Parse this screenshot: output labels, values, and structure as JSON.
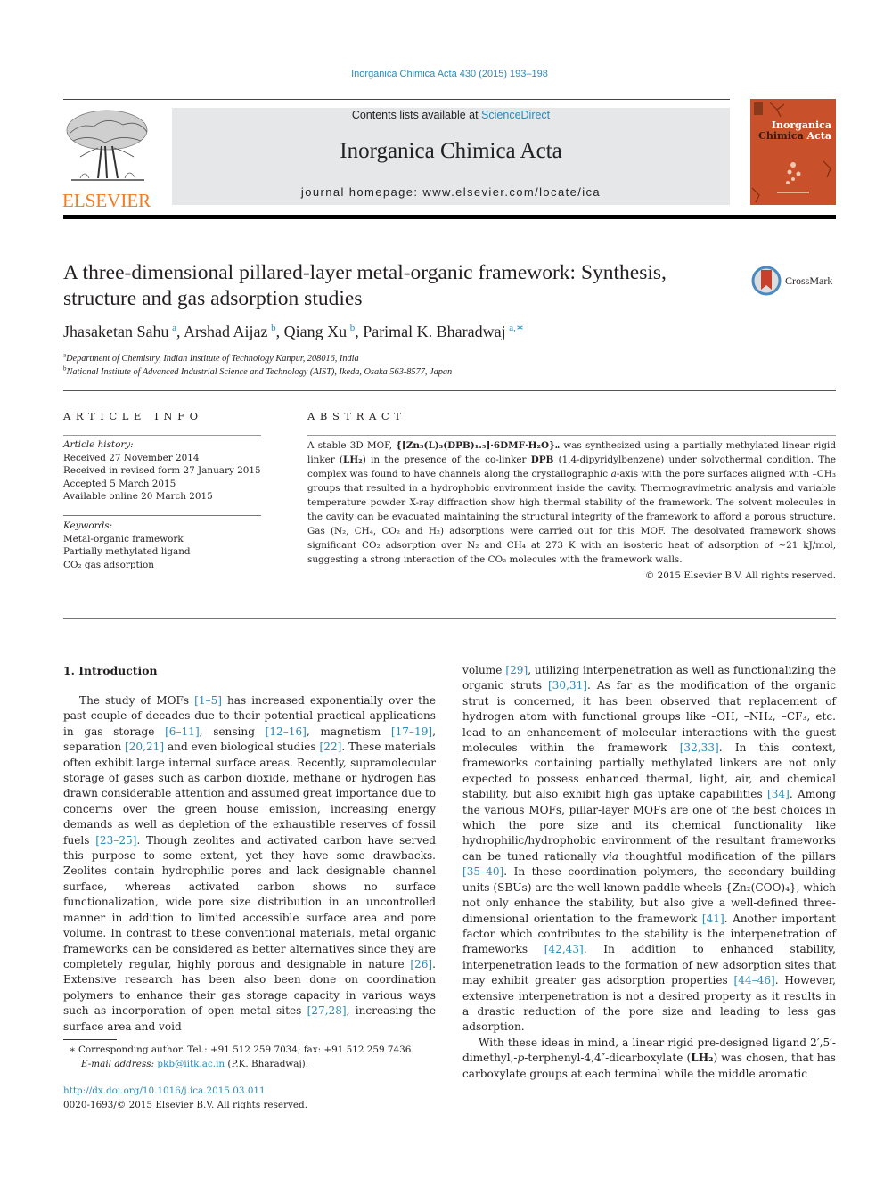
{
  "header": {
    "citation": "Inorganica Chimica Acta 430 (2015) 193–198",
    "contents_prefix": "Contents lists available at ",
    "contents_link": "ScienceDirect",
    "journal_title": "Inorganica Chimica Acta",
    "homepage": "journal homepage: www.elsevier.com/locate/ica",
    "publisher_logo": "ELSEVIER",
    "cover": {
      "line1": "Inorganica",
      "line2a": "Chimica",
      "line2b": "Acta",
      "bg_color": "#c8502a"
    },
    "link_color": "#2a8ab7",
    "logo_color": "#f47b20"
  },
  "article": {
    "title": "A three-dimensional pillared-layer metal-organic framework: Synthesis, structure and gas adsorption studies",
    "crossmark_label": "CrossMark",
    "authors": [
      {
        "name": "Jhasaketan Sahu",
        "aff": "a"
      },
      {
        "name": "Arshad Aijaz",
        "aff": "b"
      },
      {
        "name": "Qiang Xu",
        "aff": "b"
      },
      {
        "name": "Parimal K. Bharadwaj",
        "aff": "a,∗"
      }
    ],
    "affiliations": [
      {
        "mark": "a",
        "text": "Department of Chemistry, Indian Institute of Technology Kanpur, 208016, India"
      },
      {
        "mark": "b",
        "text": "National Institute of Advanced Industrial Science and Technology (AIST), Ikeda, Osaka 563-8577, Japan"
      }
    ]
  },
  "article_info": {
    "heading": "ARTICLE INFO",
    "history_label": "Article history:",
    "history": [
      "Received 27 November 2014",
      "Received in revised form 27 January 2015",
      "Accepted 5 March 2015",
      "Available online 20 March 2015"
    ],
    "keywords_label": "Keywords:",
    "keywords": [
      "Metal-organic framework",
      "Partially methylated ligand",
      "CO₂ gas adsorption"
    ]
  },
  "abstract": {
    "heading": "ABSTRACT",
    "s1_pre": "A stable 3D MOF, ",
    "formula": "{[Zn₃(L)₃(DPB)₁.₅]·6DMF·H₂O}ₙ",
    "s1_post": " was synthesized using a partially methylated linear rigid linker (",
    "lh2": "LH₂",
    "s1_mid": ") in the presence of the co-linker ",
    "dpb": "DPB",
    "s1_end": " (1,4-dipyridylbenzene) under solvothermal condition. The complex was found to have channels along the crystallographic ",
    "axis": "a",
    "s2": "-axis with the pore surfaces aligned with –CH₃ groups that resulted in a hydrophobic environment inside the cavity. Thermogravimetric analysis and variable temperature powder X-ray diffraction show high thermal stability of the framework. The solvent molecules in the cavity can be evacuated maintaining the structural integrity of the framework to afford a porous structure. Gas (N₂, CH₄, CO₂ and H₂) adsorptions were carried out for this MOF. The desolvated framework shows significant CO₂ adsorption over N₂ and CH₄ at 273 K with an isosteric heat of adsorption of ~21 kJ/mol, suggesting a strong interaction of the CO₂ molecules with the framework walls.",
    "copyright": "© 2015 Elsevier B.V. All rights reserved."
  },
  "body": {
    "section_heading": "1. Introduction",
    "left": [
      {
        "t": "The study of MOFs "
      },
      {
        "r": "[1–5]"
      },
      {
        "t": " has increased exponentially over the past couple of decades due to their potential practical applications in gas storage "
      },
      {
        "r": "[6–11]"
      },
      {
        "t": ", sensing "
      },
      {
        "r": "[12–16]"
      },
      {
        "t": ", magnetism "
      },
      {
        "r": "[17–19]"
      },
      {
        "t": ", separation "
      },
      {
        "r": "[20,21]"
      },
      {
        "t": " and even biological studies "
      },
      {
        "r": "[22]"
      },
      {
        "t": ". These materials often exhibit large internal surface areas. Recently, supramolecular storage of gases such as carbon dioxide, methane or hydrogen has drawn considerable attention and assumed great importance due to concerns over the green house emission, increasing energy demands as well as depletion of the exhaustible reserves of fossil fuels "
      },
      {
        "r": "[23–25]"
      },
      {
        "t": ". Though zeolites and activated carbon have served this purpose to some extent, yet they have some drawbacks. Zeolites contain hydrophilic pores and lack designable channel surface, whereas activated carbon shows no surface functionalization, wide pore size distribution in an uncontrolled manner in addition to limited accessible surface area and pore volume. In contrast to these conventional materials, metal organic frameworks can be considered as better alternatives since they are completely regular, highly porous and designable in nature "
      },
      {
        "r": "[26]"
      },
      {
        "t": ". Extensive research has been also been done on coordination polymers to enhance their gas storage capacity in various ways such as incorporation of open metal sites "
      },
      {
        "r": "[27,28]"
      },
      {
        "t": ", increasing the surface area and void"
      }
    ],
    "right_p1": [
      {
        "t": "volume "
      },
      {
        "r": "[29]"
      },
      {
        "t": ", utilizing interpenetration as well as functionalizing the organic struts "
      },
      {
        "r": "[30,31]"
      },
      {
        "t": ". As far as the modification of the organic strut is concerned, it has been observed that replacement of hydrogen atom with functional groups like –OH, –NH₂, –CF₃, etc. lead to an enhancement of molecular interactions with the guest molecules within the framework "
      },
      {
        "r": "[32,33]"
      },
      {
        "t": ". In this context, frameworks containing partially methylated linkers are not only expected to possess enhanced thermal, light, air, and chemical stability, but also exhibit high gas uptake capabilities "
      },
      {
        "r": "[34]"
      },
      {
        "t": ". Among the various MOFs, pillar-layer MOFs are one of the best choices in which the pore size and its chemical functionality like hydrophilic/hydrophobic environment of the resultant frameworks can be tuned rationally "
      },
      {
        "i": "via"
      },
      {
        "t": " thoughtful modification of the pillars "
      },
      {
        "r": "[35–40]"
      },
      {
        "t": ". In these coordination polymers, the secondary building units (SBUs) are the well-known paddle-wheels {Zn₂(COO)₄}, which not only enhance the stability, but also give a well-defined three-dimensional orientation to the framework "
      },
      {
        "r": "[41]"
      },
      {
        "t": ". Another important factor which contributes to the stability is the interpenetration of frameworks "
      },
      {
        "r": "[42,43]"
      },
      {
        "t": ". In addition to enhanced stability, interpenetration leads to the formation of new adsorption sites that may exhibit greater gas adsorption properties "
      },
      {
        "r": "[44–46]"
      },
      {
        "t": ". However, extensive interpenetration is not a desired property as it results in a drastic reduction of the pore size and leading to less gas adsorption."
      }
    ],
    "right_p2": [
      {
        "t": "With these ideas in mind, a linear rigid pre-designed ligand 2′,5′-dimethyl,-"
      },
      {
        "i": "p"
      },
      {
        "t": "-terphenyl-4,4″-dicarboxylate ("
      },
      {
        "b": "LH₂"
      },
      {
        "t": ") was chosen, that has carboxylate groups at each terminal while the middle aromatic"
      }
    ]
  },
  "footnote": {
    "star": "∗",
    "corresponding": " Corresponding author. Tel.: +91 512 259 7034; fax: +91 512 259 7436.",
    "email_label": "E-mail address: ",
    "email": "pkb@iitk.ac.in",
    "email_suffix": " (P.K. Bharadwaj)."
  },
  "doi": {
    "url": "http://dx.doi.org/10.1016/j.ica.2015.03.011",
    "rights": "0020-1693/© 2015 Elsevier B.V. All rights reserved."
  }
}
